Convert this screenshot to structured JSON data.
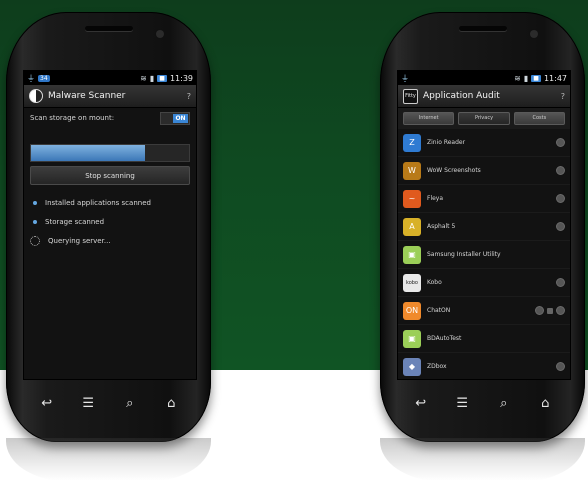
{
  "colors": {
    "accent": "#3a86d6",
    "background_green": "#0f4a21"
  },
  "left_phone": {
    "status_bar": {
      "notification_badge": "34",
      "clock": "11:39",
      "battery": "■"
    },
    "app": {
      "title": "Malware Scanner",
      "help": "?",
      "setting_label": "Scan storage on mount:",
      "toggle_value": "ON",
      "progress_fraction": 0.72,
      "stop_button": "Stop scanning",
      "status_items": [
        {
          "text": "Installed applications scanned",
          "kind": "done"
        },
        {
          "text": "Storage scanned",
          "kind": "done"
        },
        {
          "text": "Querying server...",
          "kind": "pending"
        }
      ]
    }
  },
  "right_phone": {
    "status_bar": {
      "clock": "11:47",
      "battery": "■"
    },
    "app": {
      "title": "Application Audit",
      "icon_text": "Fitty",
      "help": "?",
      "tabs": [
        "Internet",
        "Privacy",
        "Costs"
      ],
      "apps": [
        {
          "name": "Zinio Reader",
          "icon": "Z",
          "color": "#2f7bd2",
          "flags": 1,
          "lock": false
        },
        {
          "name": "WoW Screenshots",
          "icon": "W",
          "color": "#b87a18",
          "flags": 1,
          "lock": false
        },
        {
          "name": "Fleya",
          "icon": "~",
          "color": "#e05a1e",
          "flags": 1,
          "lock": false
        },
        {
          "name": "Asphalt 5",
          "icon": "A",
          "color": "#d8b128",
          "flags": 1,
          "lock": false
        },
        {
          "name": "Samsung Installer Utility",
          "icon": "▣",
          "color": "#9bcf58",
          "flags": 0,
          "lock": false
        },
        {
          "name": "Kobo",
          "icon": "kobo",
          "color": "#e9e9e9",
          "flags": 1,
          "lock": false
        },
        {
          "name": "ChatON",
          "icon": "ON",
          "color": "#f08a2c",
          "flags": 1,
          "lock": true
        },
        {
          "name": "BDAutoTest",
          "icon": "▣",
          "color": "#9bcf58",
          "flags": 0,
          "lock": false
        },
        {
          "name": "ZDbox",
          "icon": "◆",
          "color": "#6b84b8",
          "flags": 1,
          "lock": false
        }
      ]
    }
  },
  "nav_buttons": [
    "↩",
    "☰",
    "⌕",
    "⌂"
  ]
}
